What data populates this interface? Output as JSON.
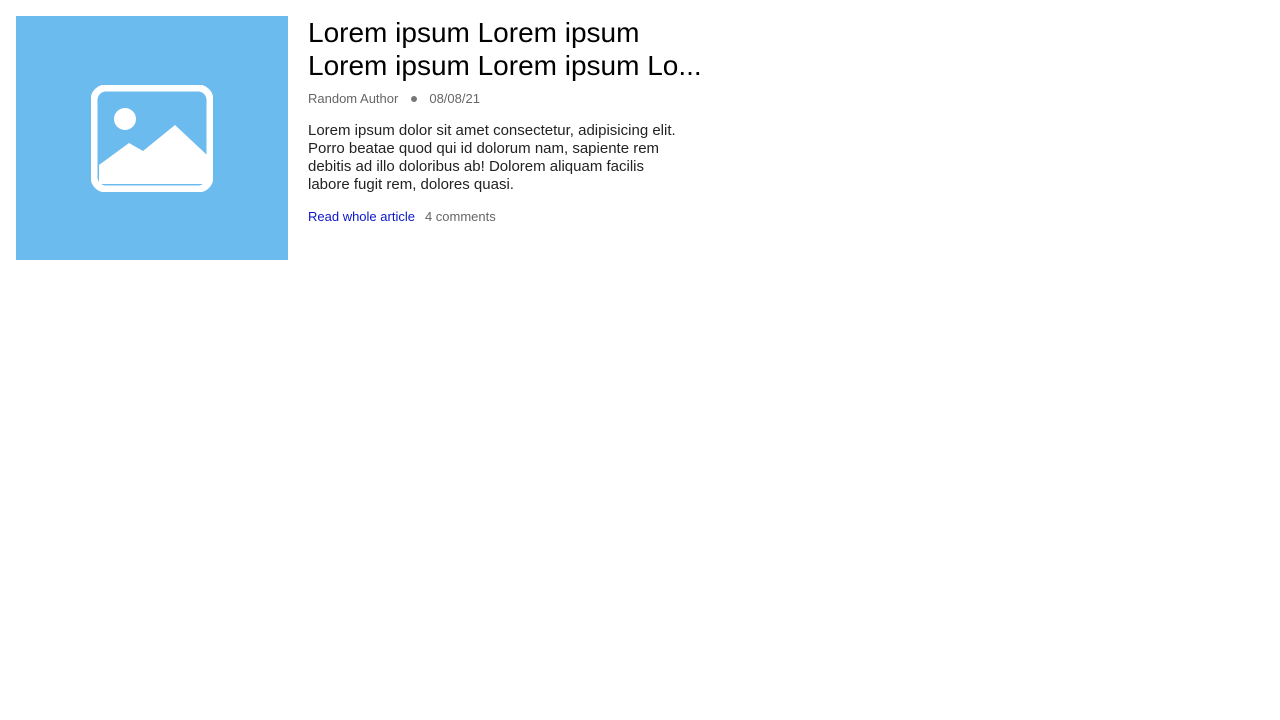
{
  "article": {
    "title_line1": "Lorem ipsum Lorem ipsum",
    "title_line2": "Lorem ipsum Lorem ipsum Lo...",
    "author": "Random Author",
    "date": "08/08/21",
    "excerpt": "Lorem ipsum dolor sit amet consectetur, adipisicing elit. Porro beatae quod qui id dolorum nam, sapiente rem debitis ad illo doloribus ab! Dolorem aliquam facilis labore fugit rem, dolores quasi.",
    "read_more_label": "Read whole article",
    "comments_label": "4 comments"
  },
  "thumbnail": {
    "icon": "image-placeholder-icon",
    "background_color": "#6cbbee"
  },
  "colors": {
    "link": "#0b16c9",
    "meta": "#666666"
  }
}
